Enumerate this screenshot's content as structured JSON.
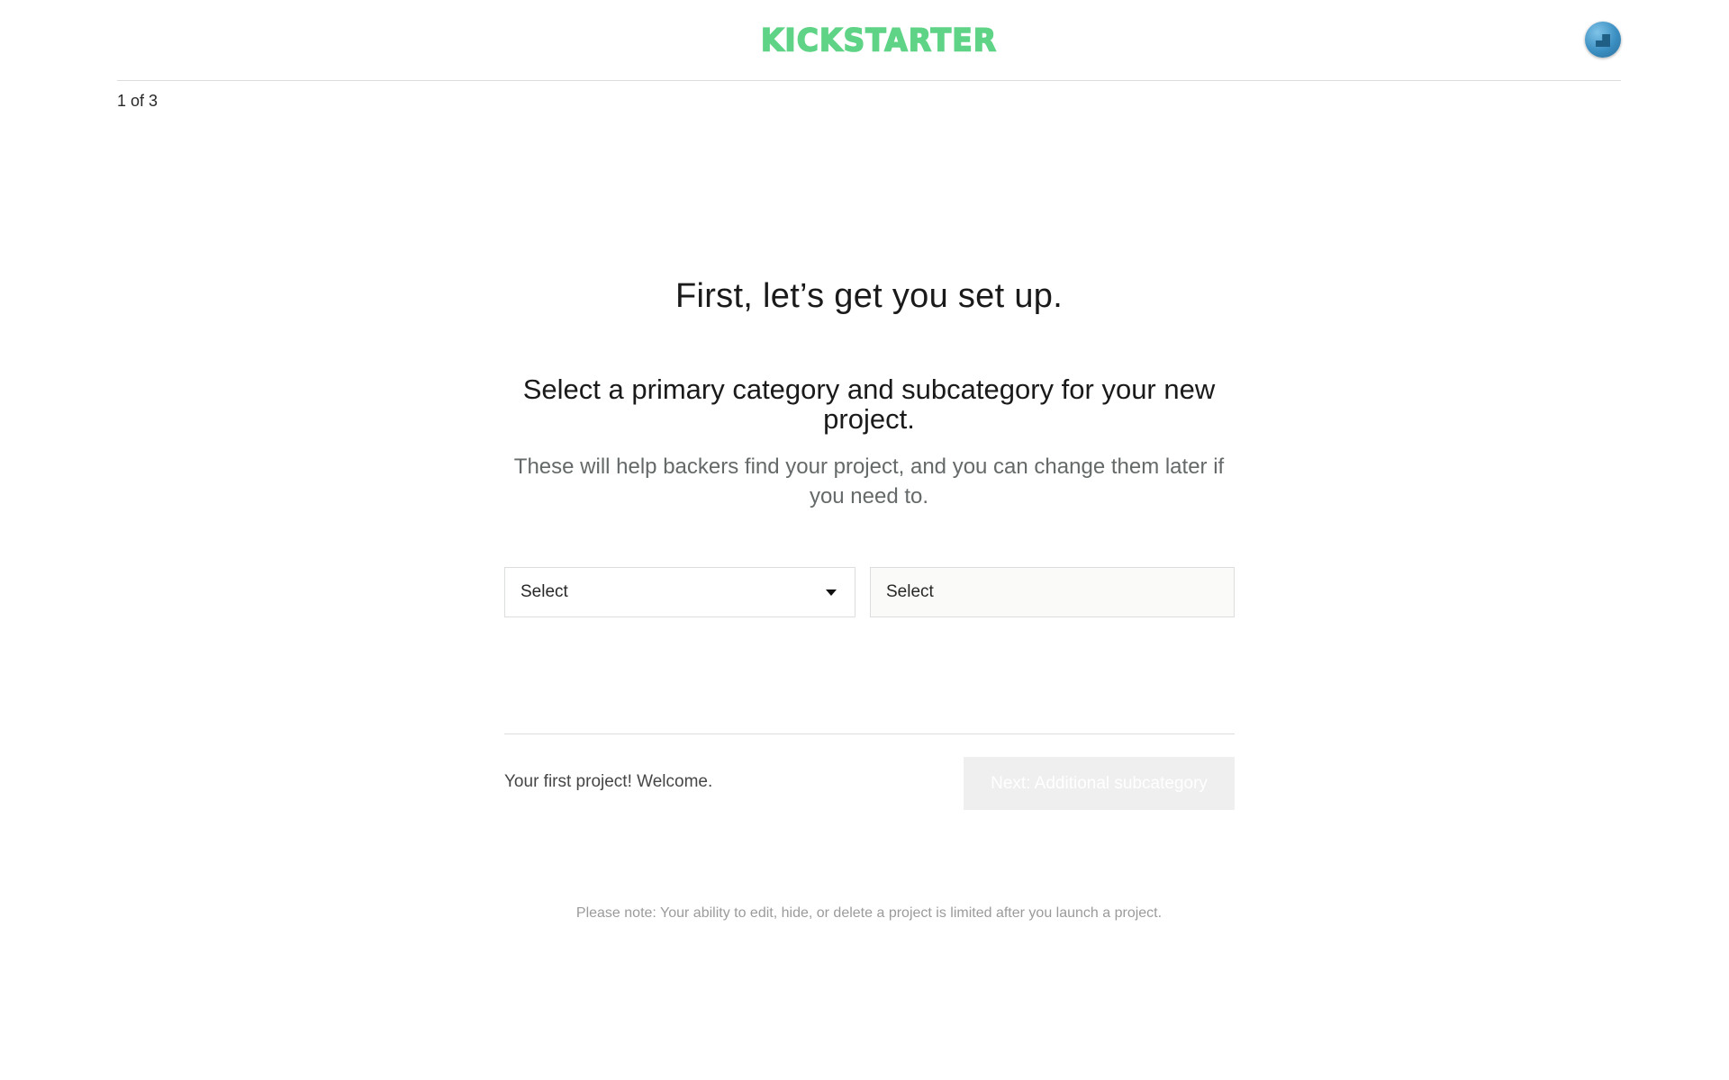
{
  "header": {
    "logo_text": "KICKSTARTER",
    "brand_color": "#5fd386",
    "avatar_icon": "user-avatar"
  },
  "progress": {
    "step_text": "1 of 3"
  },
  "main": {
    "title": "First, let’s get you set up.",
    "subtitle": "Select a primary category and subcategory for your new project.",
    "description": "These will help backers find your project, and you can change them later if you need to.",
    "category_select": {
      "value": "Select",
      "icon": "caret-down-icon"
    },
    "subcategory_select": {
      "value": "Select"
    }
  },
  "footer": {
    "welcome_text": "Your first project! Welcome.",
    "next_button_label": "Next: Additional subcategory",
    "note": "Please note: Your ability to edit, hide, or delete a project is limited after you launch a project."
  }
}
